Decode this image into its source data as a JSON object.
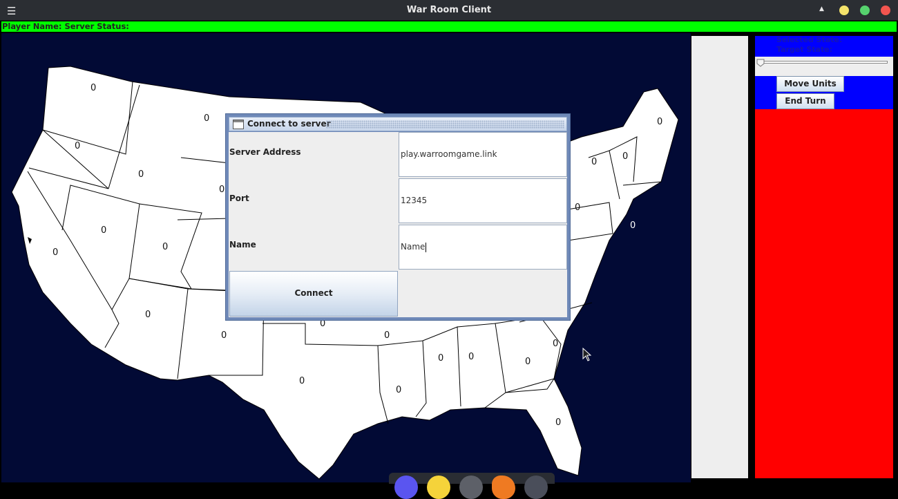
{
  "window": {
    "title": "War Room Client",
    "menu_icon": "hamburger-icon",
    "controls": {
      "up_icon": "triangle-up-icon",
      "minimize_color": "#f4e36b",
      "maximize_color": "#56d36e",
      "close_color": "#f2554f"
    }
  },
  "status_bar": {
    "text": "Player Name: Server Status:",
    "color": "#00ff00"
  },
  "map": {
    "background": "#020a35",
    "state_value": "0"
  },
  "right_panel": {
    "selected_state_label": "Selected State:",
    "target_state_label": "Target State:",
    "move_units_label": "Move Units",
    "end_turn_label": "End Turn",
    "slider_value": 0
  },
  "dialog": {
    "title": "Connect to server",
    "server_address_label": "Server Address",
    "server_address_value": "play.warroomgame.link",
    "port_label": "Port",
    "port_value": "12345",
    "name_label": "Name",
    "name_value": "Name",
    "connect_label": "Connect"
  },
  "dock": {
    "icons": [
      "browser-icon",
      "notes-icon",
      "settings-icon",
      "firefox-icon",
      "terminal-icon"
    ]
  }
}
